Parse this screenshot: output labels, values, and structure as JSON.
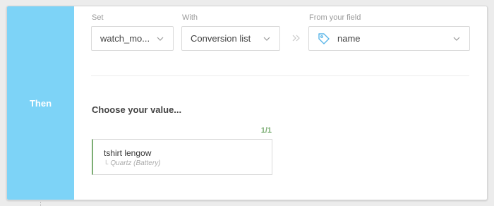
{
  "rule": {
    "then_label": "Then",
    "set": {
      "label": "Set",
      "value": "watch_mo..."
    },
    "with": {
      "label": "With",
      "value": "Conversion list"
    },
    "from": {
      "label": "From your field",
      "value": "name"
    },
    "choose_title": "Choose your value...",
    "counter": "1/1",
    "choice": {
      "main": "tshirt lengow",
      "sub": "Quartz (Battery)"
    }
  },
  "colors": {
    "then_panel": "#7dd3f7",
    "accent_green": "#7cae74",
    "tag_icon": "#5bb6e8"
  },
  "icons": [
    "chevron-down-icon",
    "double-chevron-right-icon",
    "tag-icon",
    "sub-item-arrow-icon"
  ]
}
